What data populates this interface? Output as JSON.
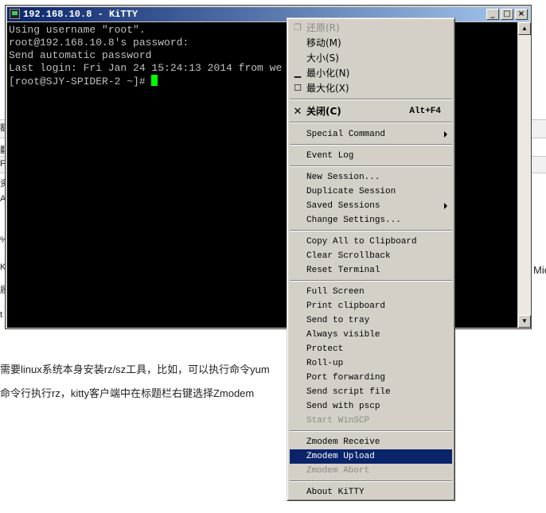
{
  "window": {
    "title": "192.168.10.8 - KiTTY"
  },
  "terminal": {
    "lines": [
      "Using username \"root\".",
      "root@192.168.10.8's password:",
      "Send automatic password",
      "Last login: Fri Jan 24 15:24:13 2014 from we",
      "[root@SJY-SPIDER-2 ~]# "
    ]
  },
  "background": {
    "line1": "需要linux系统本身安装rz/sz工具，比如，可以执行命令yum",
    "line2": "命令行执行rz，kitty客户端中在标题栏右键选择Zmodem",
    "edge_fragment_right": "Mic",
    "left_fragments": [
      "额",
      "翻",
      "F",
      "资",
      "A",
      "%",
      "Ki",
      "履",
      "t"
    ]
  },
  "menu": {
    "sys": [
      {
        "label": "还原(R)",
        "disabled": true,
        "icon": "restore-icon"
      },
      {
        "label": "移动(M)",
        "disabled": false
      },
      {
        "label": "大小(S)",
        "disabled": false
      },
      {
        "label": "最小化(N)",
        "disabled": false,
        "icon": "minimize-icon"
      },
      {
        "label": "最大化(X)",
        "disabled": false,
        "icon": "maximize-icon"
      }
    ],
    "close": {
      "label": "关闭(C)",
      "shortcut": "Alt+F4",
      "icon": "close-icon"
    },
    "special": "Special Command",
    "event_log": "Event Log",
    "session": [
      "New Session...",
      "Duplicate Session",
      "Saved Sessions",
      "Change Settings..."
    ],
    "clip": [
      "Copy All to Clipboard",
      "Clear Scrollback",
      "Reset Terminal"
    ],
    "misc": [
      "Full Screen",
      "Print clipboard",
      "Send to tray",
      "Always visible",
      "Protect",
      "Roll-up",
      "Port forwarding",
      "Send script file",
      "Send with pscp",
      "Start WinSCP"
    ],
    "zmodem": [
      "Zmodem Receive",
      "Zmodem Upload",
      "Zmodem Abort"
    ],
    "about": "About KiTTY",
    "highlighted": "Zmodem Upload"
  }
}
